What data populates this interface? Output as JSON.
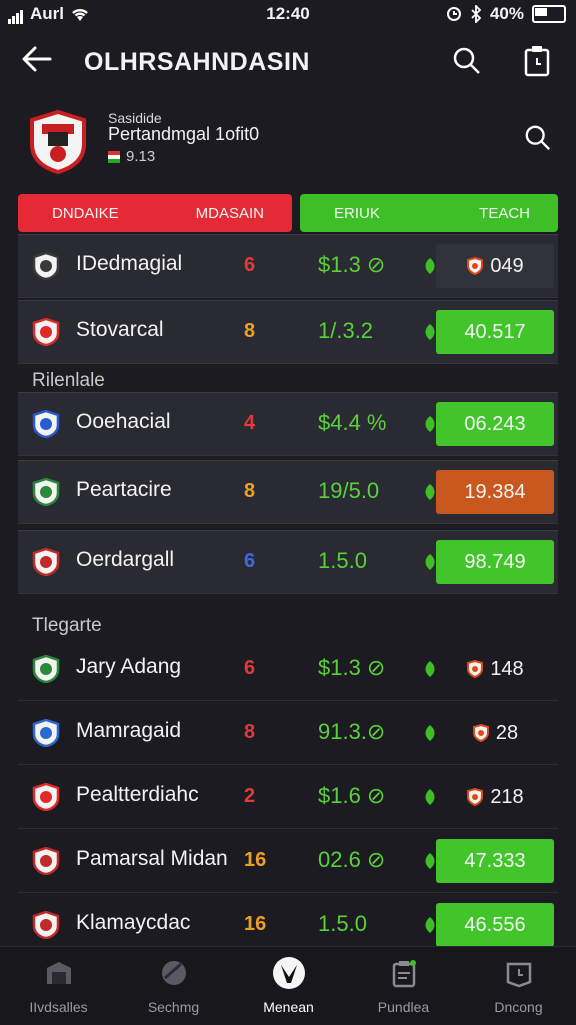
{
  "status": {
    "carrier": "Aurl",
    "time": "12:40",
    "battery": "40%"
  },
  "header": {
    "title": "OLHRSAHNDASIN"
  },
  "team": {
    "line1": "Sasidide",
    "line2": "Pertandmgal 1ofit0",
    "line3": "9.13"
  },
  "tabs": {
    "left_a": "DNDAIKE",
    "left_b": "MDASAIN",
    "right_a": "ERIUK",
    "right_b": "TEACH"
  },
  "colors": {
    "red": "#e42a34",
    "green": "#3fbf27",
    "orange": "#c9581e",
    "bg": "#1b1b21"
  },
  "top_rows": [
    {
      "name": "IDedmagial",
      "num": "6",
      "num_color": "#e03a3a",
      "price": "$1.3 ⊘",
      "value": "049",
      "value_style": "dark",
      "crest": "#3a3a3a"
    },
    {
      "name": "Stovarcal",
      "num": "8",
      "num_color": "#f0a020",
      "price": "1/.3.2",
      "value": "40.517",
      "value_style": "green",
      "crest": "#e02a2a"
    }
  ],
  "section1": "Rilenlale",
  "mid_rows": [
    {
      "name": "Ooehacial",
      "num": "4",
      "num_color": "#e03a3a",
      "price": "$4.4 %",
      "value": "06.243",
      "value_style": "green",
      "crest": "#2a5ad0"
    },
    {
      "name": "Peartacire",
      "num": "8",
      "num_color": "#f0a020",
      "price": "19/5.0",
      "value": "19.384",
      "value_style": "orange",
      "crest": "#2a8a3a"
    },
    {
      "name": "Oerdargall",
      "num": "6",
      "num_color": "#3a6ae0",
      "price": "1.5.0",
      "value": "98.749",
      "value_style": "green",
      "crest": "#c02a2a"
    }
  ],
  "section2": "Tlegarte",
  "list_rows": [
    {
      "name": "Jary Adang",
      "num": "6",
      "num_color": "#e03a3a",
      "price": "$1.3 ⊘",
      "value": "148",
      "value_style": "none",
      "crest": "#2a8a3a"
    },
    {
      "name": "Mamragaid",
      "num": "8",
      "num_color": "#e03a3a",
      "price": "91.3.⊘",
      "value": "28",
      "value_style": "none",
      "crest": "#2a6ad0"
    },
    {
      "name": "Pealtterdiahc",
      "num": "2",
      "num_color": "#e03a3a",
      "price": "$1.6 ⊘",
      "value": "218",
      "value_style": "none",
      "crest": "#e02a2a"
    },
    {
      "name": "Pamarsal Midan",
      "num": "16",
      "num_color": "#f0a020",
      "price": "02.6 ⊘",
      "value": "47.333",
      "value_style": "green",
      "crest": "#c02a2a"
    },
    {
      "name": "Klamaycdac",
      "num": "16",
      "num_color": "#f0a020",
      "price": "1.5.0",
      "value": "46.556",
      "value_style": "green",
      "crest": "#c02a2a"
    }
  ],
  "bottom_nav": [
    {
      "label": "IIvdsalles",
      "icon": "stadium-icon"
    },
    {
      "label": "Sechmg",
      "icon": "ball-icon"
    },
    {
      "label": "Menean",
      "icon": "player-icon",
      "active": true
    },
    {
      "label": "Pundlea",
      "icon": "clipboard-icon"
    },
    {
      "label": "Dncong",
      "icon": "clock-icon"
    }
  ]
}
